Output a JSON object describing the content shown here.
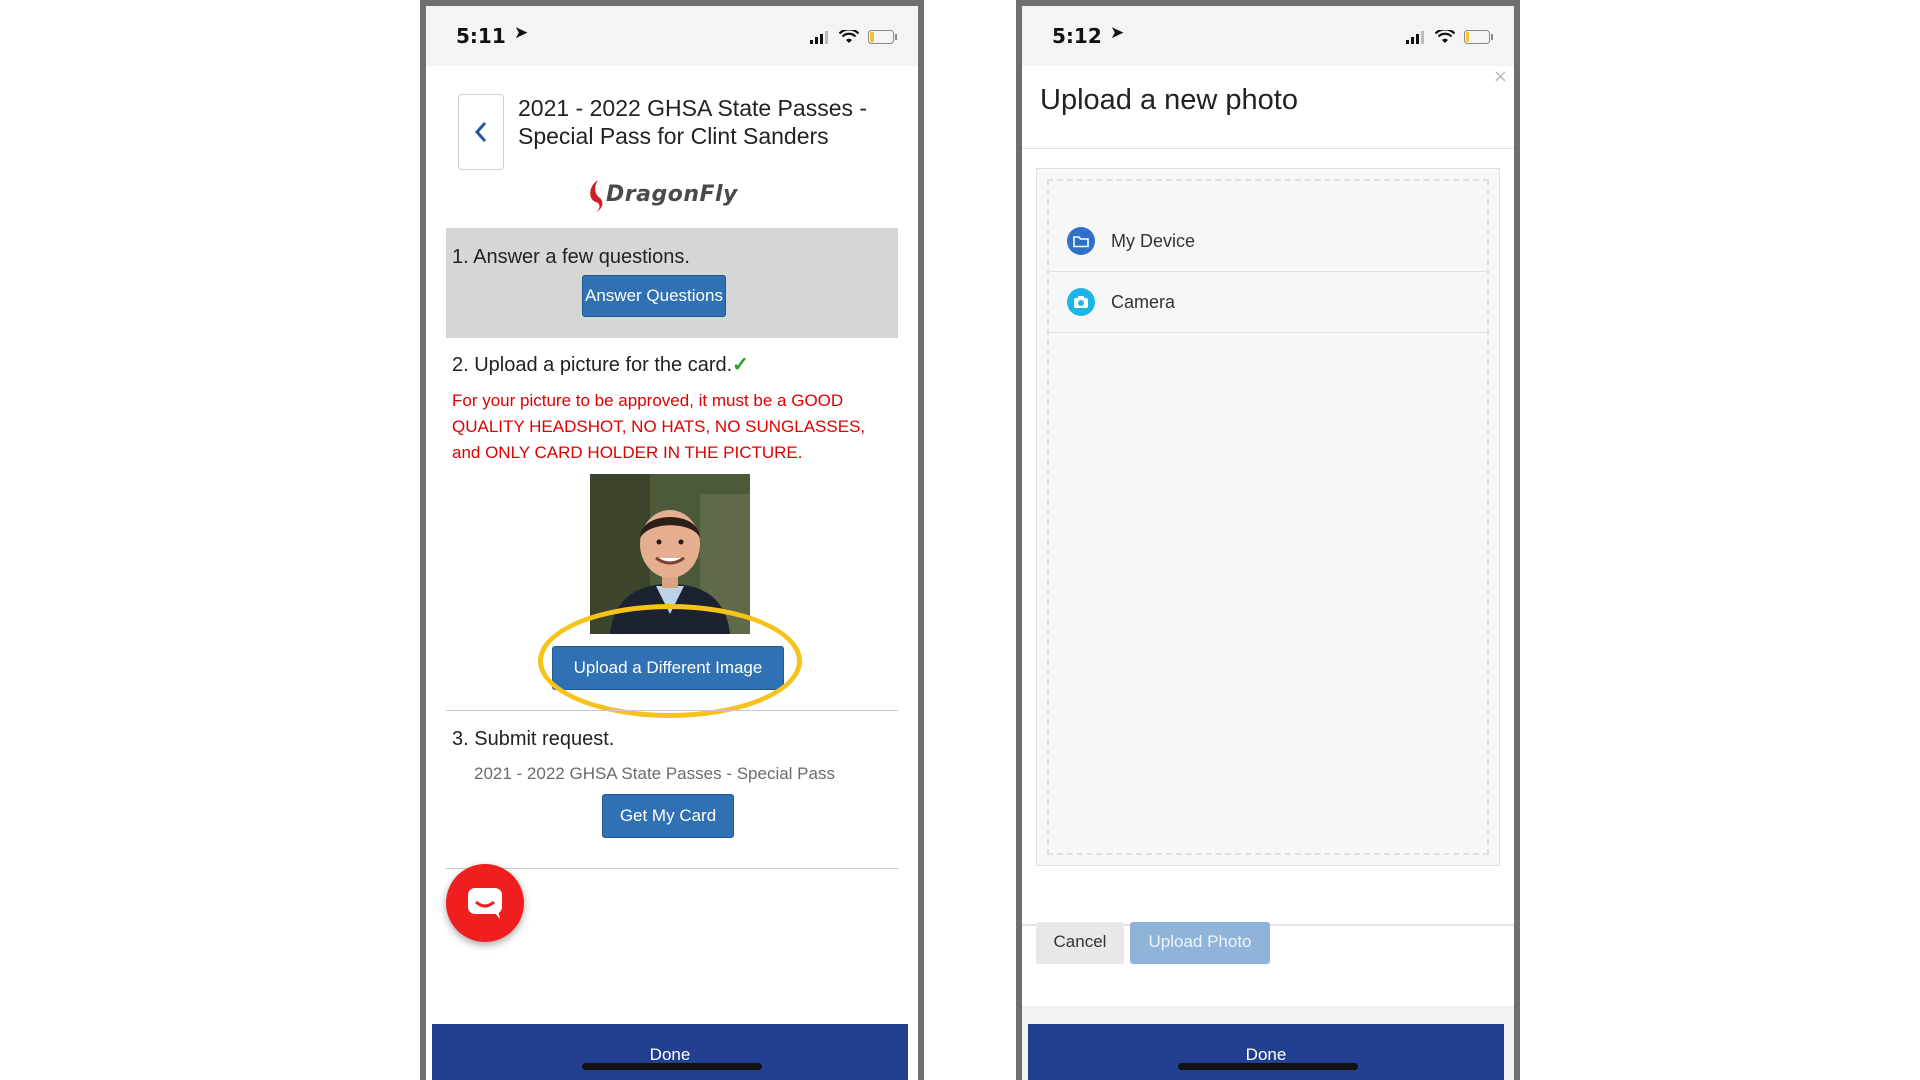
{
  "left_phone": {
    "status": {
      "time": "5:11"
    },
    "pass_title": "2021 - 2022 GHSA State Passes - Special Pass for Clint Sanders",
    "logo_text": "DragonFly",
    "step1": {
      "label": "1. Answer a few questions.",
      "button": "Answer Questions"
    },
    "step2": {
      "label": "2. Upload a picture for the card.",
      "check": "✓",
      "warning": "For your picture to be approved, it must be a GOOD QUALITY HEADSHOT, NO HATS, NO SUNGLASSES, and ONLY CARD HOLDER IN THE PICTURE.",
      "button": "Upload a Different Image"
    },
    "step3": {
      "label": "3. Submit request.",
      "pass_name": "2021 - 2022 GHSA State Passes - Special Pass",
      "button": "Get My Card"
    },
    "done_label": "Done"
  },
  "right_phone": {
    "status": {
      "time": "5:12"
    },
    "modal_title": "Upload a new photo",
    "close_glyph": "×",
    "sources": [
      {
        "label": "My Device",
        "icon": "folder-icon",
        "color": "#2f71c9"
      },
      {
        "label": "Camera",
        "icon": "camera-icon",
        "color": "#19b6e6"
      }
    ],
    "cancel_label": "Cancel",
    "upload_label": "Upload Photo",
    "done_label": "Done"
  },
  "colors": {
    "primary_button": "#2f71b3",
    "done_bar": "#233f8f",
    "warning_text": "#e00000",
    "highlight_ring": "#f7c31a",
    "chat_bubble": "#ef1f1f"
  }
}
